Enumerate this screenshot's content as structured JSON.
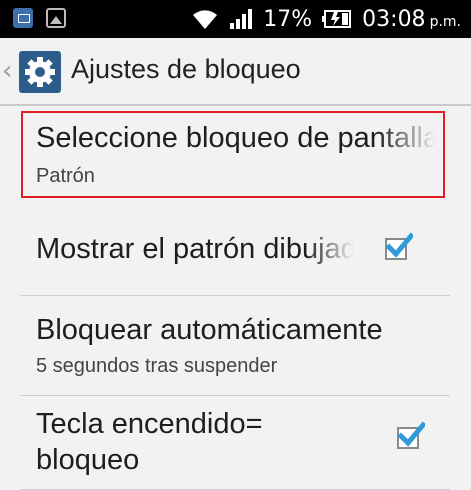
{
  "status_bar": {
    "battery_percent": "17%",
    "time": "03:08",
    "ampm": "p.m."
  },
  "action_bar": {
    "title": "Ajustes de bloqueo"
  },
  "preferences": [
    {
      "title": "Seleccione bloqueo de pantalla",
      "summary": "Patrón",
      "highlighted": true
    },
    {
      "title": "Mostrar el patrón dibujado",
      "checked": true
    },
    {
      "title": "Bloquear automáticamente",
      "summary": "5 segundos tras suspender"
    },
    {
      "title_line1": "Tecla encendido=",
      "title_line2": "bloqueo",
      "checked": true
    }
  ],
  "colors": {
    "accent": "#2f9bd8",
    "highlight_border": "#e21d24",
    "app_icon_bg": "#2d5d8c"
  }
}
